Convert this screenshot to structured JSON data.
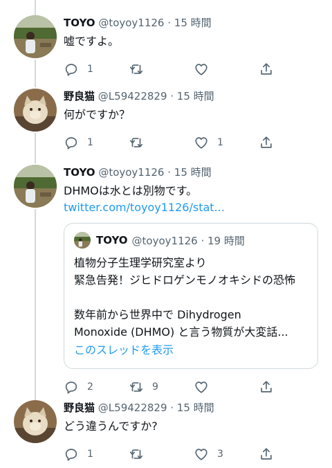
{
  "tweets": [
    {
      "name": "TOYO",
      "meta": "@toyoy1126 · 15 時間",
      "text": "嘘ですよ。",
      "reply_count": "1",
      "retweet_count": "",
      "like_count": "",
      "avatar": "landscape-person"
    },
    {
      "name": "野良猫",
      "meta": "@L59422829 · 15 時間",
      "text": "何がですか？",
      "reply_count": "1",
      "retweet_count": "",
      "like_count": "1",
      "avatar": "cat"
    },
    {
      "name": "TOYO",
      "meta": "@toyoy1126 · 15 時間",
      "text": "DHMOは水とは別物です。",
      "link": "twitter.com/toyoy1126/stat...",
      "reply_count": "2",
      "retweet_count": "9",
      "like_count": "",
      "avatar": "landscape-person",
      "quote": {
        "name": "TOYO",
        "meta": "@toyoy1126 · 19 時間",
        "lines": [
          "植物分子生理学研究室より",
          "緊急告発！ジヒドロゲンモノオキシドの恐怖",
          "",
          "数年前から世界中で Dihydrogen",
          "Monoxide (DHMO) と言う物質が大変話..."
        ],
        "show_thread": "このスレッドを表示"
      }
    },
    {
      "name": "野良猫",
      "meta": "@L59422829 · 15 時間",
      "text": "どう違うんですか?",
      "reply_count": "1",
      "retweet_count": "",
      "like_count": "3",
      "avatar": "cat"
    }
  ],
  "colors": {
    "link": "#1d9bf0",
    "secondary_text": "#536471",
    "thread_line": "#cfd9de"
  }
}
